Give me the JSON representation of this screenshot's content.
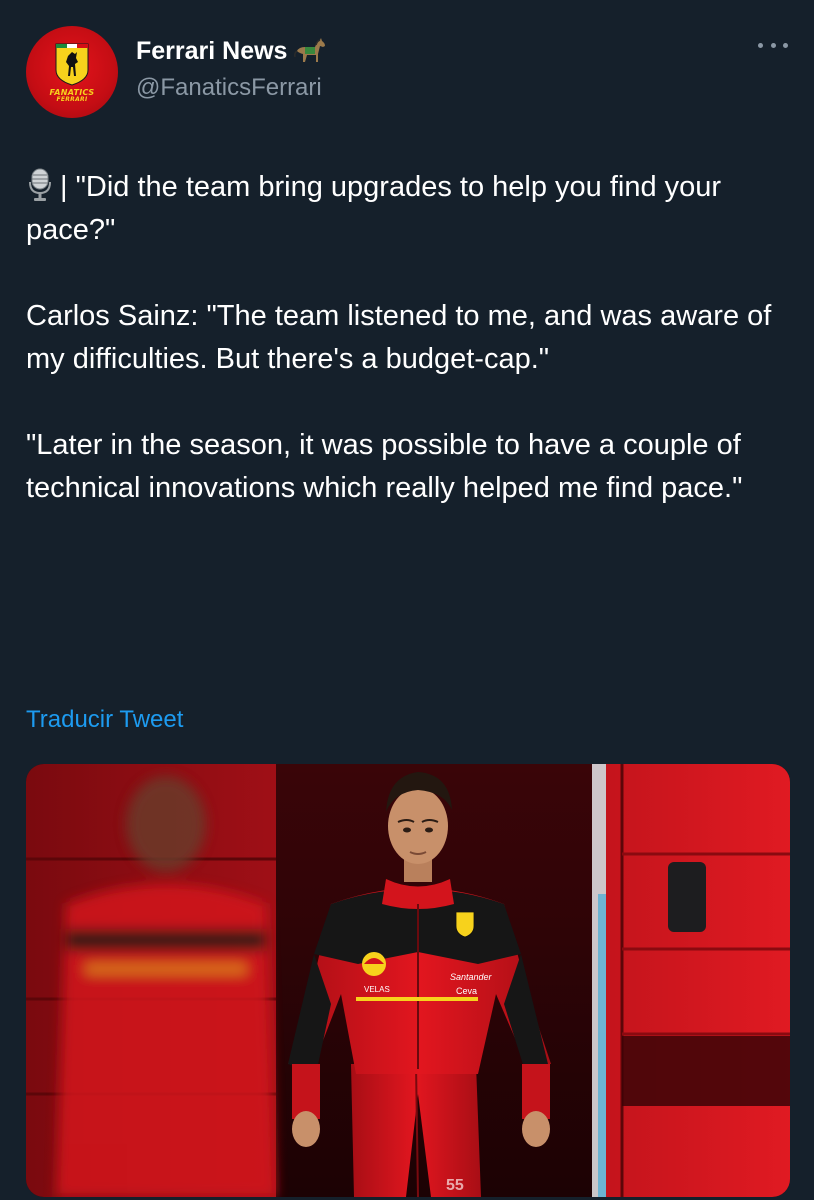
{
  "author": {
    "display_name": "Ferrari News",
    "handle": "@FanaticsFerrari",
    "avatar_text_line1": "FANATICS",
    "avatar_text_line2": "FERRARI"
  },
  "tweet": {
    "paragraphs": [
      "| \"Did the team bring upgrades to help you find your pace?\"",
      "Carlos Sainz: \"The team listened to me, and was aware of my difficulties. But there's a budget-cap.\"",
      "\"Later in the season, it was possible to have a couple of technical innovations which really helped me find pace.\""
    ],
    "translate_label": "Traducir Tweet"
  },
  "media": {
    "suit_text_santander": "Santander",
    "suit_text_velas": "VELAS",
    "suit_text_ceva": "Ceva",
    "suit_number": "55"
  },
  "icons": {
    "horse": "horse-emoji-icon",
    "microphone": "microphone-emoji-icon",
    "more": "more-options-icon"
  },
  "colors": {
    "background": "#15202b",
    "text": "#ffffff",
    "secondary_text": "#8b98a5",
    "link": "#1d9bf0",
    "ferrari_red": "#d40f16",
    "ferrari_yellow": "#f7d21c"
  }
}
